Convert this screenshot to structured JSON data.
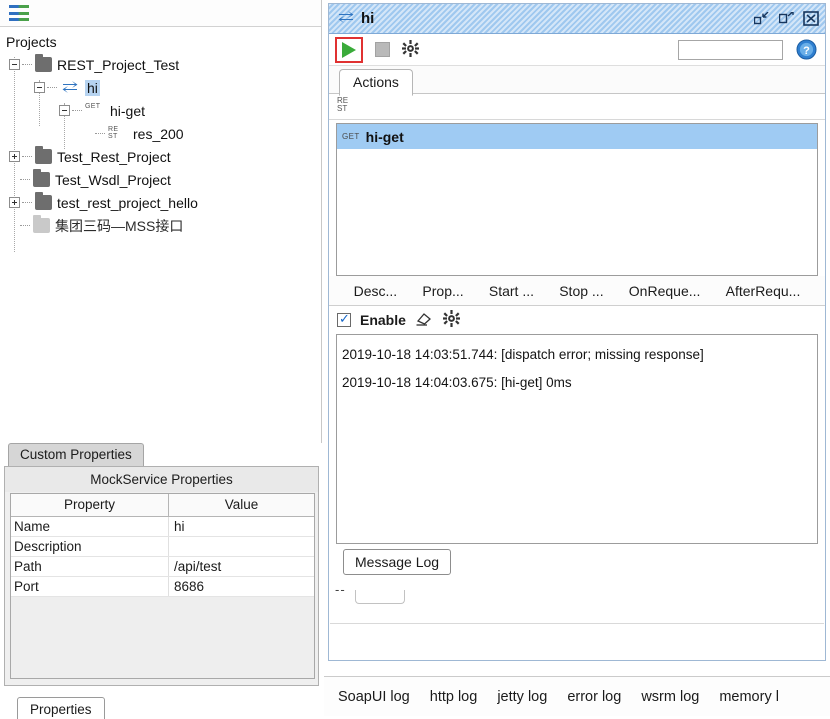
{
  "left": {
    "nav_icon": "navigator-icon",
    "tree_root": "Projects",
    "tree": [
      {
        "label": "REST_Project_Test",
        "icon": "folder-icon",
        "toggle": "minus",
        "depth": 0,
        "selected": false
      },
      {
        "label": "hi",
        "icon": "mock-service-icon",
        "toggle": "minus",
        "depth": 1,
        "selected": true
      },
      {
        "label": "hi-get",
        "icon": "get-method-icon",
        "toggle": "minus",
        "depth": 2,
        "selected": false
      },
      {
        "label": "res_200",
        "icon": "rest-response-icon",
        "toggle": "none",
        "depth": 3,
        "selected": false
      },
      {
        "label": "Test_Rest_Project",
        "icon": "folder-icon",
        "toggle": "plus",
        "depth": 0,
        "selected": false
      },
      {
        "label": "Test_Wsdl_Project",
        "icon": "folder-icon",
        "toggle": "none",
        "depth": 0,
        "selected": false
      },
      {
        "label": "test_rest_project_hello",
        "icon": "folder-icon",
        "toggle": "plus",
        "depth": 0,
        "selected": false
      },
      {
        "label": "集团三码—MSS接口",
        "icon": "folder-icon-disabled",
        "toggle": "none",
        "depth": 0,
        "selected": false
      }
    ],
    "custom_properties_tab": "Custom Properties",
    "props_title": "MockService Properties",
    "props_headers": [
      "Property",
      "Value"
    ],
    "props_rows": [
      {
        "property": "Name",
        "value": "hi"
      },
      {
        "property": "Description",
        "value": ""
      },
      {
        "property": "Path",
        "value": "/api/test"
      },
      {
        "property": "Port",
        "value": "8686"
      }
    ],
    "properties_button": "Properties"
  },
  "window": {
    "title": "hi",
    "title_icon": "mock-service-icon",
    "controls": [
      {
        "name": "restore-down-button",
        "glyph": "restore"
      },
      {
        "name": "maximize-button",
        "glyph": "maximize"
      },
      {
        "name": "close-button",
        "glyph": "close"
      }
    ],
    "toolbar": {
      "run_icon": "run-play-icon",
      "stop_icon": "stop-square-icon",
      "options_icon": "gear-icon",
      "search_value": "",
      "search_placeholder": "",
      "help_icon": "help-circle-icon"
    },
    "tab": "Actions",
    "list_header_icon": "rest-icon",
    "operations": [
      {
        "method": "GET",
        "name": "hi-get",
        "selected": true
      }
    ],
    "subtabs": [
      "Desc...",
      "Prop...",
      "Start ...",
      "Stop ...",
      "OnReque...",
      "AfterRequ..."
    ],
    "enable": {
      "checked": true,
      "label": "Enable",
      "clear_icon": "eraser-icon",
      "settings_icon": "gear-icon"
    },
    "log_lines": [
      "2019-10-18 14:03:51.744: [dispatch error; missing response]",
      "2019-10-18 14:04:03.675: [hi-get] 0ms"
    ],
    "message_log_button": "Message Log",
    "dashes": "--"
  },
  "log_tabs": [
    "SoapUI log",
    "http log",
    "jetty log",
    "error log",
    "wsrm log",
    "memory l"
  ],
  "colors": {
    "title_bar": "#9fc8ef",
    "selection": "#b6d3f0",
    "list_selection": "#9fcbf3",
    "run_highlight": "#e03131",
    "play_green": "#3aab3a",
    "accent_blue": "#1667c8"
  }
}
